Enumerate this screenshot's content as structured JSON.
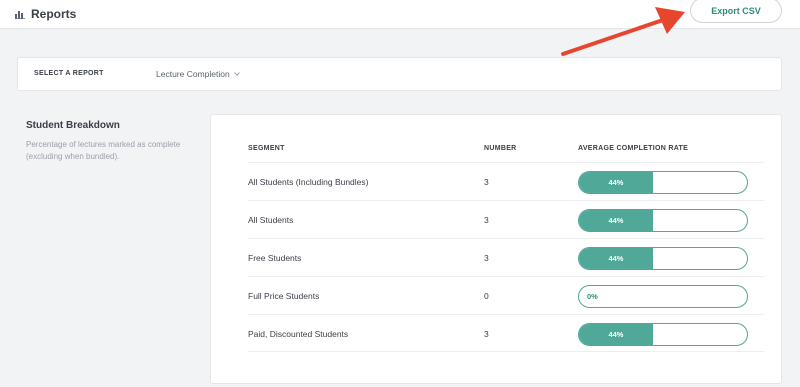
{
  "header": {
    "title": "Reports",
    "export_label": "Export CSV"
  },
  "selector": {
    "label": "SELECT A REPORT",
    "value": "Lecture Completion"
  },
  "section": {
    "title": "Student Breakdown",
    "description": "Percentage of lectures marked as complete (excluding when bundled)."
  },
  "table": {
    "headers": [
      "SEGMENT",
      "NUMBER",
      "AVERAGE COMPLETION RATE"
    ],
    "rows": [
      {
        "segment": "All Students (Including Bundles)",
        "number": "3",
        "rate": 0.44,
        "rate_label": "44%"
      },
      {
        "segment": "All Students",
        "number": "3",
        "rate": 0.44,
        "rate_label": "44%"
      },
      {
        "segment": "Free Students",
        "number": "3",
        "rate": 0.44,
        "rate_label": "44%"
      },
      {
        "segment": "Full Price Students",
        "number": "0",
        "rate": 0.0,
        "rate_label": "0%"
      },
      {
        "segment": "Paid, Discounted Students",
        "number": "3",
        "rate": 0.44,
        "rate_label": "44%"
      }
    ]
  },
  "colors": {
    "accent": "#4fa898",
    "annotation_arrow": "#e8452e"
  }
}
